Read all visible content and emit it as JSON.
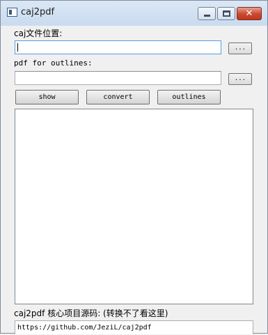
{
  "window": {
    "title": "caj2pdf",
    "close_glyph": "✕",
    "colors": {
      "titlebar": "#c9dbef",
      "close": "#c9482f",
      "focus_border": "#569de5"
    }
  },
  "form": {
    "caj_label": "caj文件位置:",
    "caj_value": "",
    "caj_browse": "...",
    "pdf_label": "pdf for outlines:",
    "pdf_value": "",
    "pdf_browse": "..."
  },
  "actions": {
    "show": "show",
    "convert": "convert",
    "outlines": "outlines"
  },
  "output": {
    "text": ""
  },
  "footer": {
    "label": "caj2pdf 核心项目源码: (转换不了看这里)",
    "link": "https://github.com/JeziL/caj2pdf"
  },
  "icons": [
    "app-icon",
    "minimize-icon",
    "maximize-icon",
    "close-icon"
  ]
}
